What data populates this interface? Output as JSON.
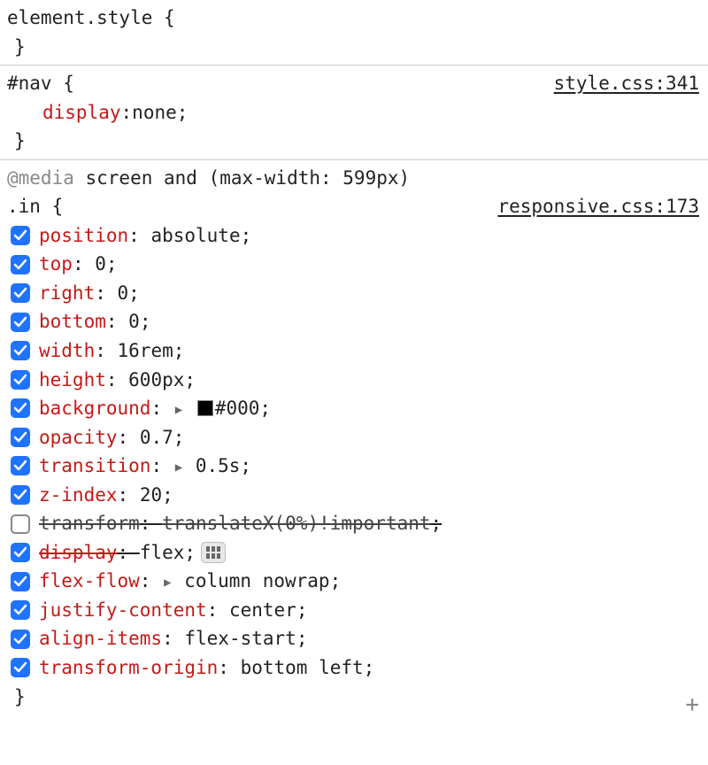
{
  "section1": {
    "selector": "element.style",
    "open": "{",
    "close": "}"
  },
  "section2": {
    "selector": "#nav",
    "open": "{",
    "close": "}",
    "source": "style.css:341",
    "prop": {
      "name": "display",
      "value": "none"
    }
  },
  "section3": {
    "media_prefix": "@media",
    "media_rest": " screen and (max-width: 599px)",
    "selector": ".in",
    "open": "{",
    "close": "}",
    "source": "responsive.css:173",
    "props": [
      {
        "name": "position",
        "value": "absolute",
        "checked": true,
        "struck": false,
        "expand": false,
        "swatch": false,
        "badge": false
      },
      {
        "name": "top",
        "value": "0",
        "checked": true,
        "struck": false,
        "expand": false,
        "swatch": false,
        "badge": false
      },
      {
        "name": "right",
        "value": "0",
        "checked": true,
        "struck": false,
        "expand": false,
        "swatch": false,
        "badge": false
      },
      {
        "name": "bottom",
        "value": "0",
        "checked": true,
        "struck": false,
        "expand": false,
        "swatch": false,
        "badge": false
      },
      {
        "name": "width",
        "value": "16rem",
        "checked": true,
        "struck": false,
        "expand": false,
        "swatch": false,
        "badge": false
      },
      {
        "name": "height",
        "value": "600px",
        "checked": true,
        "struck": false,
        "expand": false,
        "swatch": false,
        "badge": false
      },
      {
        "name": "background",
        "value": "#000",
        "checked": true,
        "struck": false,
        "expand": true,
        "swatch": true,
        "badge": false
      },
      {
        "name": "opacity",
        "value": "0.7",
        "checked": true,
        "struck": false,
        "expand": false,
        "swatch": false,
        "badge": false
      },
      {
        "name": "transition",
        "value": "0.5s",
        "checked": true,
        "struck": false,
        "expand": true,
        "swatch": false,
        "badge": false
      },
      {
        "name": "z-index",
        "value": "20",
        "checked": true,
        "struck": false,
        "expand": false,
        "swatch": false,
        "badge": false
      },
      {
        "name": "transform",
        "value": "translateX(0%)!important",
        "checked": false,
        "struck": true,
        "expand": false,
        "swatch": false,
        "badge": false
      },
      {
        "name": "display",
        "value": "flex",
        "checked": true,
        "struck": "name",
        "expand": false,
        "swatch": false,
        "badge": true
      },
      {
        "name": "flex-flow",
        "value": "column nowrap",
        "checked": true,
        "struck": false,
        "expand": true,
        "swatch": false,
        "badge": false
      },
      {
        "name": "justify-content",
        "value": "center",
        "checked": true,
        "struck": false,
        "expand": false,
        "swatch": false,
        "badge": false
      },
      {
        "name": "align-items",
        "value": "flex-start",
        "checked": true,
        "struck": false,
        "expand": false,
        "swatch": false,
        "badge": false
      },
      {
        "name": "transform-origin",
        "value": "bottom left",
        "checked": true,
        "struck": false,
        "expand": false,
        "swatch": false,
        "badge": false
      }
    ],
    "add": "+"
  }
}
